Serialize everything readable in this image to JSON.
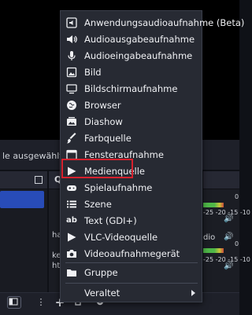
{
  "background": {
    "no_source_text": "le ausgewählt",
    "sources_header": "Q",
    "left_fragments": [
      "hab",
      "ken",
      "htsk"
    ],
    "right_fragments": [
      "0",
      "-25 -20 -15 -10",
      "dio",
      "0",
      "-25 -20 -15 -10"
    ],
    "bottom_buttons": [
      "+",
      "⋮"
    ]
  },
  "menu": {
    "items": [
      {
        "label": "Anwendungsaudioaufnahme (Beta)",
        "icon": "app-audio-icon"
      },
      {
        "label": "Audioausgabeaufnahme",
        "icon": "speaker-icon"
      },
      {
        "label": "Audioeingabeaufnahme",
        "icon": "microphone-icon"
      },
      {
        "label": "Bild",
        "icon": "image-icon"
      },
      {
        "label": "Bildschirmaufnahme",
        "icon": "monitor-icon"
      },
      {
        "label": "Browser",
        "icon": "globe-icon"
      },
      {
        "label": "Diashow",
        "icon": "slideshow-icon"
      },
      {
        "label": "Farbquelle",
        "icon": "paintbrush-icon"
      },
      {
        "label": "Fensteraufnahme",
        "icon": "window-icon"
      },
      {
        "label": "Medienquelle",
        "icon": "play-icon"
      },
      {
        "label": "Spielaufnahme",
        "icon": "gamepad-icon"
      },
      {
        "label": "Szene",
        "icon": "list-icon"
      },
      {
        "label": "Text (GDI+)",
        "icon": "text-icon"
      },
      {
        "label": "VLC-Videoquelle",
        "icon": "play-icon"
      },
      {
        "label": "Videoaufnahmegerät",
        "icon": "camera-icon"
      }
    ],
    "group_label": "Gruppe",
    "deprecated_label": "Veraltet",
    "highlighted_item": "Medienquelle",
    "highlight_color": "#d7212d"
  }
}
